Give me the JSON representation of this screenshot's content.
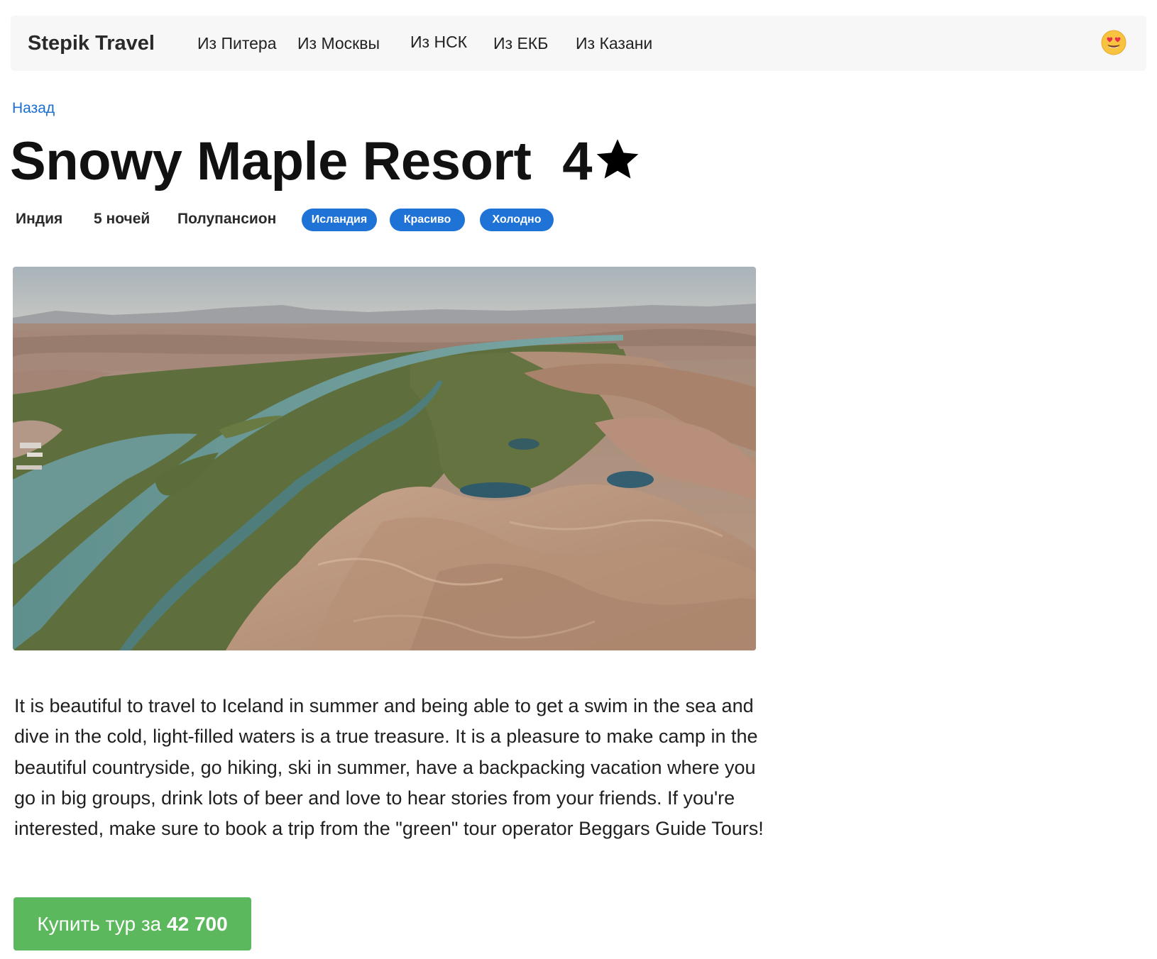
{
  "navbar": {
    "brand": "Stepik Travel",
    "links": [
      {
        "label": "Из Питера"
      },
      {
        "label": "Из Москвы"
      },
      {
        "label": "Из НСК"
      },
      {
        "label": "Из ЕКБ"
      },
      {
        "label": "Из Казани"
      }
    ],
    "user_icon": "heart-eyes-emoji-icon"
  },
  "back_link": "Назад",
  "tour": {
    "title": "Snowy Maple Resort",
    "stars": "4",
    "star_icon": "star-icon",
    "country": "Индия",
    "nights": "5 ночей",
    "meal": "Полупансион",
    "tags": [
      "Исландия",
      "Красиво",
      "Холодно"
    ],
    "image_icon": "landscape-photo",
    "description": "It is beautiful to travel to Iceland in summer and being able to get a swim in the sea and dive in the cold, light-filled waters is a true treasure.  It is a pleasure to make camp in the beautiful countryside, go hiking, ski in summer, have a backpacking vacation where you go in big groups, drink lots of beer and love to hear stories from your friends.  If you're interested, make sure to book a trip from the \"green\" tour operator Beggars Guide Tours!"
  },
  "buy": {
    "label_prefix": "Купить тур за",
    "price": "42 700"
  },
  "colors": {
    "navbar_bg": "#f7f7f8",
    "link": "#1a6fd0",
    "badge": "#1f72d6",
    "buy_button": "#5cb85c"
  }
}
